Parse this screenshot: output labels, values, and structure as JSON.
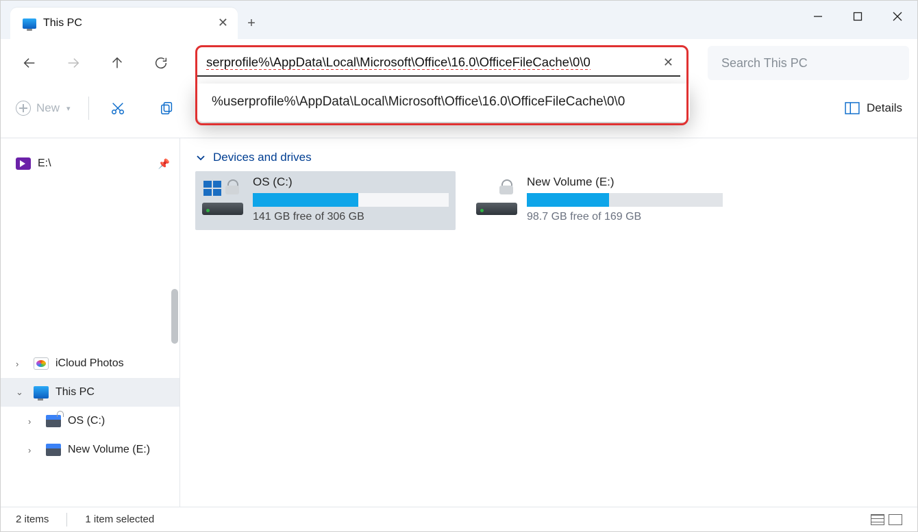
{
  "tab": {
    "title": "This PC"
  },
  "address": {
    "value": "serprofile%\\AppData\\Local\\Microsoft\\Office\\16.0\\OfficeFileCache\\0\\0",
    "suggestion": "%userprofile%\\AppData\\Local\\Microsoft\\Office\\16.0\\OfficeFileCache\\0\\0"
  },
  "search": {
    "placeholder": "Search This PC"
  },
  "toolbar": {
    "new": "New",
    "details": "Details"
  },
  "sidebar": {
    "pinned": "E:\\",
    "items": [
      "iCloud Photos",
      "This PC",
      "OS (C:)",
      "New Volume (E:)"
    ]
  },
  "group": "Devices and drives",
  "drives": [
    {
      "name": "OS (C:)",
      "free": "141 GB free of 306 GB",
      "fill_pct": 54,
      "selected": true
    },
    {
      "name": "New Volume (E:)",
      "free": "98.7 GB free of 169 GB",
      "fill_pct": 42,
      "selected": false
    }
  ],
  "status": {
    "count": "2 items",
    "selected": "1 item selected"
  }
}
